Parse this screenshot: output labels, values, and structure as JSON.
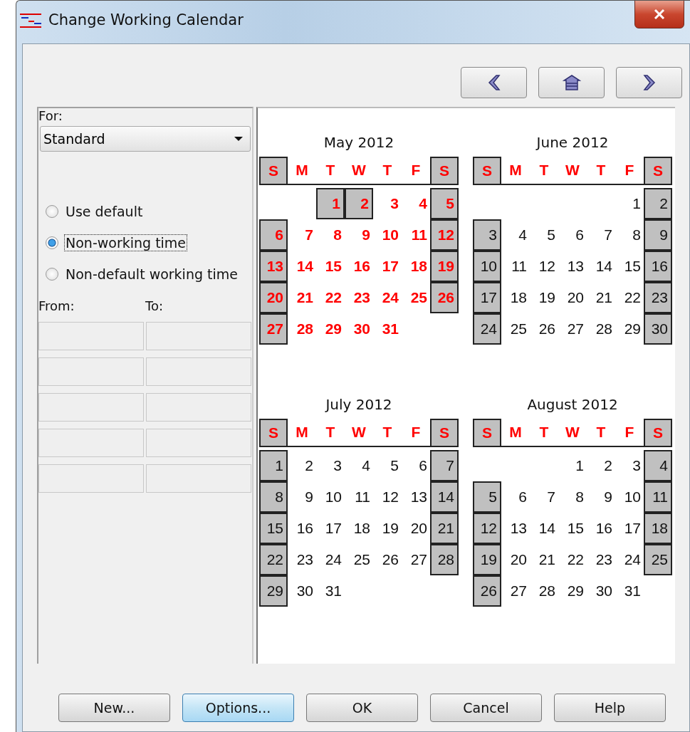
{
  "window": {
    "title": "Change Working Calendar"
  },
  "nav_buttons": [
    {
      "kind": "previous"
    },
    {
      "kind": "home"
    },
    {
      "kind": "next"
    }
  ],
  "for_label": "For:",
  "for_select": {
    "value": "Standard"
  },
  "radios": [
    {
      "label": "Use default",
      "selected": false,
      "focused": false
    },
    {
      "label": "Non-working time",
      "selected": true,
      "focused": true
    },
    {
      "label": "Non-default working time",
      "selected": false,
      "focused": false
    }
  ],
  "from_label": "From:",
  "to_label": "To:",
  "time_rows": [
    {
      "from": {
        "disabled": true
      },
      "to": {
        "disabled": true
      }
    },
    {
      "from": {
        "disabled": true
      },
      "to": {
        "disabled": true
      }
    },
    {
      "from": {
        "disabled": true
      },
      "to": {
        "disabled": true
      }
    },
    {
      "from": {
        "disabled": true
      },
      "to": {
        "disabled": true
      }
    },
    {
      "from": {
        "disabled": true
      },
      "to": {
        "disabled": true
      }
    }
  ],
  "months": [
    {
      "title": "May 2012",
      "weekdays": [
        {
          "label": "S",
          "nonworking": true
        },
        {
          "label": "M",
          "nonworking": false
        },
        {
          "label": "T",
          "nonworking": false
        },
        {
          "label": "W",
          "nonworking": false
        },
        {
          "label": "T",
          "nonworking": false
        },
        {
          "label": "F",
          "nonworking": false
        },
        {
          "label": "S",
          "nonworking": true
        }
      ],
      "weeks": [
        [
          {
            "kind": "blank"
          },
          {
            "kind": "blank"
          },
          {
            "label": "1",
            "nonworking": true,
            "selected": true
          },
          {
            "label": "2",
            "nonworking": true,
            "selected": true
          },
          {
            "label": "3",
            "nonworking": false,
            "selected": true
          },
          {
            "label": "4",
            "nonworking": false,
            "selected": true
          },
          {
            "label": "5",
            "nonworking": true,
            "selected": true
          }
        ],
        [
          {
            "label": "6",
            "nonworking": true,
            "selected": true
          },
          {
            "label": "7",
            "nonworking": false,
            "selected": true
          },
          {
            "label": "8",
            "nonworking": false,
            "selected": true
          },
          {
            "label": "9",
            "nonworking": false,
            "selected": true
          },
          {
            "label": "10",
            "nonworking": false,
            "selected": true
          },
          {
            "label": "11",
            "nonworking": false,
            "selected": true
          },
          {
            "label": "12",
            "nonworking": true,
            "selected": true
          }
        ],
        [
          {
            "label": "13",
            "nonworking": true,
            "selected": true
          },
          {
            "label": "14",
            "nonworking": false,
            "selected": true
          },
          {
            "label": "15",
            "nonworking": false,
            "selected": true
          },
          {
            "label": "16",
            "nonworking": false,
            "selected": true
          },
          {
            "label": "17",
            "nonworking": false,
            "selected": true
          },
          {
            "label": "18",
            "nonworking": false,
            "selected": true
          },
          {
            "label": "19",
            "nonworking": true,
            "selected": true
          }
        ],
        [
          {
            "label": "20",
            "nonworking": true,
            "selected": true
          },
          {
            "label": "21",
            "nonworking": false,
            "selected": true
          },
          {
            "label": "22",
            "nonworking": false,
            "selected": true
          },
          {
            "label": "23",
            "nonworking": false,
            "selected": true
          },
          {
            "label": "24",
            "nonworking": false,
            "selected": true
          },
          {
            "label": "25",
            "nonworking": false,
            "selected": true
          },
          {
            "label": "26",
            "nonworking": true,
            "selected": true
          }
        ],
        [
          {
            "label": "27",
            "nonworking": true,
            "selected": true
          },
          {
            "label": "28",
            "nonworking": false,
            "selected": true
          },
          {
            "label": "29",
            "nonworking": false,
            "selected": true
          },
          {
            "label": "30",
            "nonworking": false,
            "selected": true
          },
          {
            "label": "31",
            "nonworking": false,
            "selected": true
          }
        ]
      ]
    },
    {
      "title": "June 2012",
      "weekdays": [
        {
          "label": "S",
          "nonworking": true
        },
        {
          "label": "M",
          "nonworking": false
        },
        {
          "label": "T",
          "nonworking": false
        },
        {
          "label": "W",
          "nonworking": false
        },
        {
          "label": "T",
          "nonworking": false
        },
        {
          "label": "F",
          "nonworking": false
        },
        {
          "label": "S",
          "nonworking": true
        }
      ],
      "weeks": [
        [
          {
            "kind": "blank"
          },
          {
            "kind": "blank"
          },
          {
            "kind": "blank"
          },
          {
            "kind": "blank"
          },
          {
            "kind": "blank"
          },
          {
            "label": "1",
            "nonworking": false,
            "selected": false
          },
          {
            "label": "2",
            "nonworking": true,
            "selected": false
          }
        ],
        [
          {
            "label": "3",
            "nonworking": true,
            "selected": false
          },
          {
            "label": "4",
            "nonworking": false,
            "selected": false
          },
          {
            "label": "5",
            "nonworking": false,
            "selected": false
          },
          {
            "label": "6",
            "nonworking": false,
            "selected": false
          },
          {
            "label": "7",
            "nonworking": false,
            "selected": false
          },
          {
            "label": "8",
            "nonworking": false,
            "selected": false
          },
          {
            "label": "9",
            "nonworking": true,
            "selected": false
          }
        ],
        [
          {
            "label": "10",
            "nonworking": true,
            "selected": false
          },
          {
            "label": "11",
            "nonworking": false,
            "selected": false
          },
          {
            "label": "12",
            "nonworking": false,
            "selected": false
          },
          {
            "label": "13",
            "nonworking": false,
            "selected": false
          },
          {
            "label": "14",
            "nonworking": false,
            "selected": false
          },
          {
            "label": "15",
            "nonworking": false,
            "selected": false
          },
          {
            "label": "16",
            "nonworking": true,
            "selected": false
          }
        ],
        [
          {
            "label": "17",
            "nonworking": true,
            "selected": false
          },
          {
            "label": "18",
            "nonworking": false,
            "selected": false
          },
          {
            "label": "19",
            "nonworking": false,
            "selected": false
          },
          {
            "label": "20",
            "nonworking": false,
            "selected": false
          },
          {
            "label": "21",
            "nonworking": false,
            "selected": false
          },
          {
            "label": "22",
            "nonworking": false,
            "selected": false
          },
          {
            "label": "23",
            "nonworking": true,
            "selected": false
          }
        ],
        [
          {
            "label": "24",
            "nonworking": true,
            "selected": false
          },
          {
            "label": "25",
            "nonworking": false,
            "selected": false
          },
          {
            "label": "26",
            "nonworking": false,
            "selected": false
          },
          {
            "label": "27",
            "nonworking": false,
            "selected": false
          },
          {
            "label": "28",
            "nonworking": false,
            "selected": false
          },
          {
            "label": "29",
            "nonworking": false,
            "selected": false
          },
          {
            "label": "30",
            "nonworking": true,
            "selected": false
          }
        ]
      ]
    },
    {
      "title": "July 2012",
      "weekdays": [
        {
          "label": "S",
          "nonworking": true
        },
        {
          "label": "M",
          "nonworking": false
        },
        {
          "label": "T",
          "nonworking": false
        },
        {
          "label": "W",
          "nonworking": false
        },
        {
          "label": "T",
          "nonworking": false
        },
        {
          "label": "F",
          "nonworking": false
        },
        {
          "label": "S",
          "nonworking": true
        }
      ],
      "weeks": [
        [
          {
            "label": "1",
            "nonworking": true,
            "selected": false
          },
          {
            "label": "2",
            "nonworking": false,
            "selected": false
          },
          {
            "label": "3",
            "nonworking": false,
            "selected": false
          },
          {
            "label": "4",
            "nonworking": false,
            "selected": false
          },
          {
            "label": "5",
            "nonworking": false,
            "selected": false
          },
          {
            "label": "6",
            "nonworking": false,
            "selected": false
          },
          {
            "label": "7",
            "nonworking": true,
            "selected": false
          }
        ],
        [
          {
            "label": "8",
            "nonworking": true,
            "selected": false
          },
          {
            "label": "9",
            "nonworking": false,
            "selected": false
          },
          {
            "label": "10",
            "nonworking": false,
            "selected": false
          },
          {
            "label": "11",
            "nonworking": false,
            "selected": false
          },
          {
            "label": "12",
            "nonworking": false,
            "selected": false
          },
          {
            "label": "13",
            "nonworking": false,
            "selected": false
          },
          {
            "label": "14",
            "nonworking": true,
            "selected": false
          }
        ],
        [
          {
            "label": "15",
            "nonworking": true,
            "selected": false
          },
          {
            "label": "16",
            "nonworking": false,
            "selected": false
          },
          {
            "label": "17",
            "nonworking": false,
            "selected": false
          },
          {
            "label": "18",
            "nonworking": false,
            "selected": false
          },
          {
            "label": "19",
            "nonworking": false,
            "selected": false
          },
          {
            "label": "20",
            "nonworking": false,
            "selected": false
          },
          {
            "label": "21",
            "nonworking": true,
            "selected": false
          }
        ],
        [
          {
            "label": "22",
            "nonworking": true,
            "selected": false
          },
          {
            "label": "23",
            "nonworking": false,
            "selected": false
          },
          {
            "label": "24",
            "nonworking": false,
            "selected": false
          },
          {
            "label": "25",
            "nonworking": false,
            "selected": false
          },
          {
            "label": "26",
            "nonworking": false,
            "selected": false
          },
          {
            "label": "27",
            "nonworking": false,
            "selected": false
          },
          {
            "label": "28",
            "nonworking": true,
            "selected": false
          }
        ],
        [
          {
            "label": "29",
            "nonworking": true,
            "selected": false
          },
          {
            "label": "30",
            "nonworking": false,
            "selected": false
          },
          {
            "label": "31",
            "nonworking": false,
            "selected": false
          }
        ]
      ]
    },
    {
      "title": "August 2012",
      "weekdays": [
        {
          "label": "S",
          "nonworking": true
        },
        {
          "label": "M",
          "nonworking": false
        },
        {
          "label": "T",
          "nonworking": false
        },
        {
          "label": "W",
          "nonworking": false
        },
        {
          "label": "T",
          "nonworking": false
        },
        {
          "label": "F",
          "nonworking": false
        },
        {
          "label": "S",
          "nonworking": true
        }
      ],
      "weeks": [
        [
          {
            "kind": "blank"
          },
          {
            "kind": "blank"
          },
          {
            "kind": "blank"
          },
          {
            "label": "1",
            "nonworking": false,
            "selected": false
          },
          {
            "label": "2",
            "nonworking": false,
            "selected": false
          },
          {
            "label": "3",
            "nonworking": false,
            "selected": false
          },
          {
            "label": "4",
            "nonworking": true,
            "selected": false
          }
        ],
        [
          {
            "label": "5",
            "nonworking": true,
            "selected": false
          },
          {
            "label": "6",
            "nonworking": false,
            "selected": false
          },
          {
            "label": "7",
            "nonworking": false,
            "selected": false
          },
          {
            "label": "8",
            "nonworking": false,
            "selected": false
          },
          {
            "label": "9",
            "nonworking": false,
            "selected": false
          },
          {
            "label": "10",
            "nonworking": false,
            "selected": false
          },
          {
            "label": "11",
            "nonworking": true,
            "selected": false
          }
        ],
        [
          {
            "label": "12",
            "nonworking": true,
            "selected": false
          },
          {
            "label": "13",
            "nonworking": false,
            "selected": false
          },
          {
            "label": "14",
            "nonworking": false,
            "selected": false
          },
          {
            "label": "15",
            "nonworking": false,
            "selected": false
          },
          {
            "label": "16",
            "nonworking": false,
            "selected": false
          },
          {
            "label": "17",
            "nonworking": false,
            "selected": false
          },
          {
            "label": "18",
            "nonworking": true,
            "selected": false
          }
        ],
        [
          {
            "label": "19",
            "nonworking": true,
            "selected": false
          },
          {
            "label": "20",
            "nonworking": false,
            "selected": false
          },
          {
            "label": "21",
            "nonworking": false,
            "selected": false
          },
          {
            "label": "22",
            "nonworking": false,
            "selected": false
          },
          {
            "label": "23",
            "nonworking": false,
            "selected": false
          },
          {
            "label": "24",
            "nonworking": false,
            "selected": false
          },
          {
            "label": "25",
            "nonworking": true,
            "selected": false
          }
        ],
        [
          {
            "label": "26",
            "nonworking": true,
            "selected": false
          },
          {
            "label": "27",
            "nonworking": false,
            "selected": false
          },
          {
            "label": "28",
            "nonworking": false,
            "selected": false
          },
          {
            "label": "29",
            "nonworking": false,
            "selected": false
          },
          {
            "label": "30",
            "nonworking": false,
            "selected": false
          },
          {
            "label": "31",
            "nonworking": false,
            "selected": false
          }
        ]
      ]
    }
  ],
  "buttons": [
    {
      "label": "New...",
      "focused": false
    },
    {
      "label": "Options...",
      "focused": true
    },
    {
      "label": "OK",
      "focused": false
    },
    {
      "label": "Cancel",
      "focused": false
    },
    {
      "label": "Help",
      "focused": false
    }
  ]
}
